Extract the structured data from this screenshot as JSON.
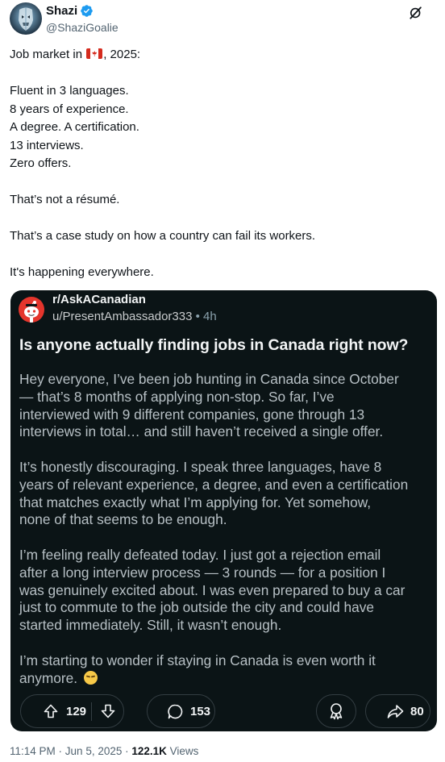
{
  "author": {
    "display_name": "Shazi",
    "handle": "@ShaziGoalie",
    "verified": true,
    "avatar_icon": "goalie-mask-avatar"
  },
  "header_action": {
    "icon": "grok-icon"
  },
  "tweet": {
    "line1_before_flag": "Job market in ",
    "flag_icon": "canada-flag-emoji",
    "line1_after_flag": ", 2025:",
    "lines_group1": [
      "Fluent in 3 languages.",
      "8 years of experience.",
      "A degree. A certification.",
      "13 interviews.",
      "Zero offers."
    ],
    "line_resume": "That’s not a résumé.",
    "line_case_study": "That’s a case study on how a country can fail its workers.",
    "line_everywhere": "It's happening everywhere."
  },
  "reddit_post": {
    "subreddit": "r/AskACanadian",
    "username": "u/PresentAmbassador333",
    "separator": " • ",
    "time": "4h",
    "title": "Is anyone actually finding jobs in Canada right now?",
    "paragraphs": [
      [
        "Hey everyone, I’ve been job hunting in Canada since October",
        "— that’s 8 months of applying non-stop. So far, I’ve",
        "interviewed with 9 different companies, gone through 13",
        "interviews in total… and still haven’t received a single offer."
      ],
      [
        "It’s honestly discouraging. I speak three languages, have 8",
        "years of relevant experience, a degree, and even a certification",
        "that matches exactly what I’m applying for. Yet somehow,",
        "none of that seems to be enough."
      ],
      [
        "I’m feeling really defeated today. I just got a rejection email",
        "after a long interview process — 3 rounds — for a position I",
        "was genuinely excited about. I was even prepared to buy a car",
        "just to commute to the job outside the city and could have",
        "started immediately. Still, it wasn’t enough."
      ],
      [
        "I’m starting to wonder if staying in Canada is even worth it",
        "anymore. "
      ]
    ],
    "end_emoji": "disappointed-face-emoji",
    "upvotes": "129",
    "comments": "153",
    "shares": "80"
  },
  "footer": {
    "time": "11:14 PM",
    "dot1": " · ",
    "date": "Jun 5, 2025",
    "dot2": " · ",
    "views_count": "122.1K",
    "views_label": " Views"
  },
  "colors": {
    "card_bg": "#0b1416",
    "verified_blue": "#1d9bf0",
    "subreddit_icon": "#e4352c",
    "muted_text": "#536471"
  }
}
